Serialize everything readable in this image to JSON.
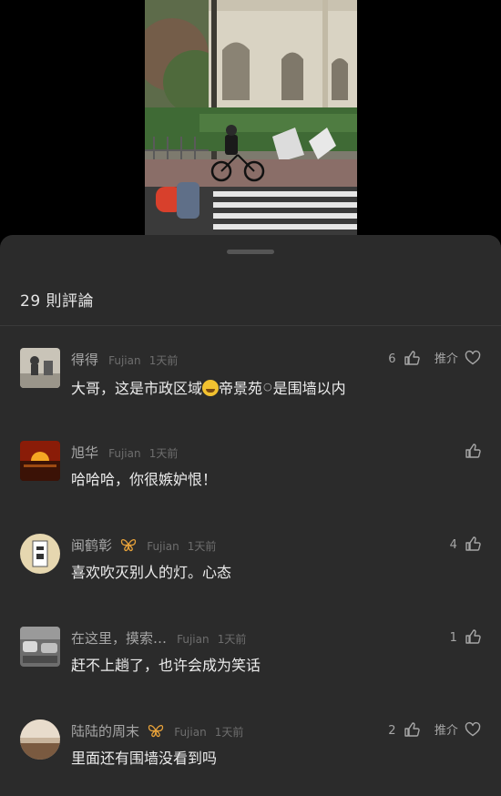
{
  "sheet": {
    "title": "29 則評論"
  },
  "comments": [
    {
      "name": "得得",
      "location": "Fujian",
      "time": "1天前",
      "likes": "6",
      "recommend": "推介",
      "text_before": "大哥，这是市政区域",
      "link": "帝景苑",
      "text_after": "是围墙以内"
    },
    {
      "name": "旭华",
      "location": "Fujian",
      "time": "1天前",
      "text": "哈哈哈，你很嫉妒恨！"
    },
    {
      "name": "闽鹤彰",
      "location": "Fujian",
      "time": "1天前",
      "likes": "4",
      "text": "喜欢吹灭别人的灯。心态"
    },
    {
      "name": "在这里，摸索…",
      "location": "Fujian",
      "time": "1天前",
      "likes": "1",
      "text": "赶不上趟了，也许会成为笑话"
    },
    {
      "name": "陆陆的周末",
      "location": "Fujian",
      "time": "1天前",
      "likes": "2",
      "recommend": "推介",
      "text": "里面还有围墙没看到吗"
    }
  ],
  "icons": {
    "like": "thumbs-up-icon",
    "recommend": "heart-icon",
    "badge": "butterfly-badge-icon",
    "search": "search-icon",
    "emoji": "laughing-emoji-icon"
  },
  "colors": {
    "sheet_bg": "#2b2b2b",
    "badge": "#e8a23a"
  }
}
